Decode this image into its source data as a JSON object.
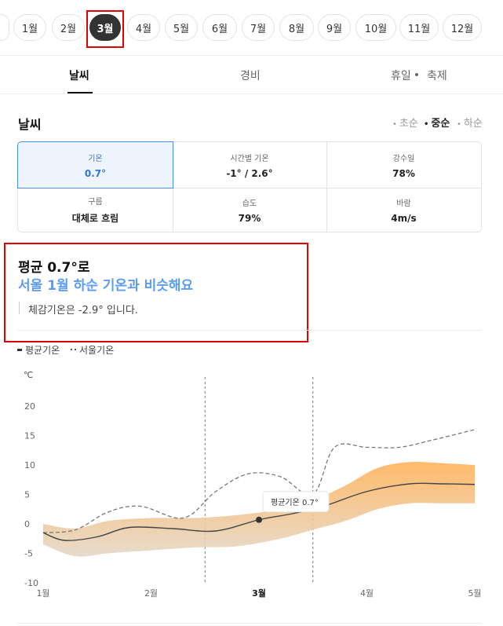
{
  "months": [
    "1월",
    "2월",
    "3월",
    "4월",
    "5월",
    "6월",
    "7월",
    "8월",
    "9월",
    "10월",
    "11월",
    "12월"
  ],
  "active_month": "3월",
  "tabs": {
    "weather": "날씨",
    "cost": "경비",
    "holiday": "휴일",
    "festival": "축제"
  },
  "section_title": "날씨",
  "periods": [
    "초순",
    "중순",
    "하순"
  ],
  "active_period": "중순",
  "stats": {
    "temp": {
      "label": "기온",
      "value": "0.7°"
    },
    "hourly": {
      "label": "시간별 기온",
      "value": "-1° / 2.6°"
    },
    "rain": {
      "label": "강수일",
      "value": "78%"
    },
    "cloud": {
      "label": "구름",
      "value": "대체로 흐림"
    },
    "humidity": {
      "label": "습도",
      "value": "79%"
    },
    "wind": {
      "label": "바람",
      "value": "4m/s"
    }
  },
  "summary": {
    "line1": "평균 0.7°로",
    "line2": "서울 1월 하순 기온과 비슷해요",
    "line3": "체감기온은 -2.9° 입니다."
  },
  "legend": {
    "avg": "평균기온",
    "seoul": "서울기온"
  },
  "chart_data": {
    "type": "line",
    "yunit": "℃",
    "yticks": [
      20,
      15,
      10,
      5,
      0,
      -5,
      -10
    ],
    "ylim": [
      -10,
      20
    ],
    "xlim": [
      1,
      5
    ],
    "x_tick_labels": [
      {
        "x": 1,
        "label": "1월"
      },
      {
        "x": 2,
        "label": "2월"
      },
      {
        "x": 3,
        "label": "3월"
      },
      {
        "x": 4,
        "label": "4월"
      },
      {
        "x": 5,
        "label": "5월"
      }
    ],
    "active_x_label": "3월",
    "highlight_range": [
      2.5,
      3.5
    ],
    "series": [
      {
        "name": "평균기온",
        "x": [
          1,
          1.2,
          1.5,
          1.8,
          2.2,
          2.6,
          3.0,
          3.3,
          3.6,
          4.0,
          4.4,
          4.7,
          5.0
        ],
        "y": [
          -1.5,
          -2.8,
          -2.2,
          -0.6,
          -0.8,
          -1.2,
          0.7,
          1.7,
          3.0,
          5.5,
          6.8,
          6.8,
          6.7
        ]
      },
      {
        "name": "서울기온",
        "x": [
          1,
          1.3,
          1.6,
          1.9,
          2.3,
          2.6,
          2.9,
          3.2,
          3.5,
          3.7,
          4.0,
          4.3,
          4.6,
          5.0
        ],
        "y": [
          -1.5,
          -1.0,
          2.0,
          3.0,
          1.0,
          5.5,
          8.5,
          8.0,
          5.0,
          13.0,
          13.0,
          13.0,
          14.2,
          16.0
        ]
      },
      {
        "name": "upper",
        "x": [
          1,
          1.3,
          1.6,
          2.0,
          2.4,
          2.8,
          3.2,
          3.5,
          3.8,
          4.1,
          4.4,
          4.7,
          5.0
        ],
        "y": [
          0,
          -0.8,
          0.5,
          1.0,
          1.0,
          1.5,
          2.5,
          4.0,
          6.5,
          9.5,
          10.5,
          10.3,
          10.0
        ]
      },
      {
        "name": "lower",
        "x": [
          1,
          1.3,
          1.6,
          2.0,
          2.4,
          2.8,
          3.2,
          3.5,
          3.8,
          4.1,
          4.4,
          4.7,
          5.0
        ],
        "y": [
          -3.5,
          -5.5,
          -5.0,
          -4.5,
          -4.0,
          -3.8,
          -2.5,
          -1.0,
          0.5,
          2.5,
          3.5,
          3.5,
          3.5
        ]
      }
    ],
    "marker": {
      "x": 3.0,
      "y": 0.7,
      "label": "평균기온 0.7°"
    },
    "colors": {
      "band_top": "#ffb35a",
      "band_bottom": "#e4d8c8",
      "avg_line": "#444444",
      "seoul_line": "#777777"
    }
  }
}
